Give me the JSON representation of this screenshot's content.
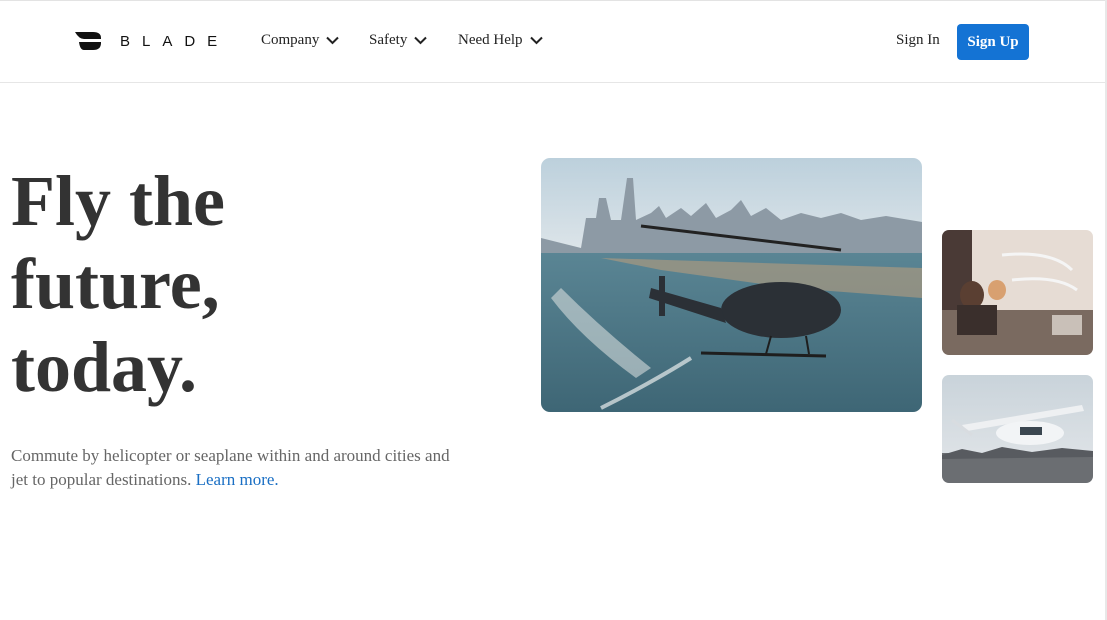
{
  "brand": {
    "name": "BLADE",
    "icon": "blade-logo-icon"
  },
  "nav": {
    "items": [
      {
        "label": "Company",
        "icon": "chevron-down-icon"
      },
      {
        "label": "Safety",
        "icon": "chevron-down-icon"
      },
      {
        "label": "Need Help",
        "icon": "chevron-down-icon"
      }
    ]
  },
  "auth": {
    "sign_in": "Sign In",
    "sign_up": "Sign Up"
  },
  "hero": {
    "headline_lines": [
      "Fly the",
      "future,",
      "today."
    ],
    "description": "Commute by helicopter or seaplane within and around cities and jet to popular destinations.",
    "learn_more": "Learn more."
  },
  "colors": {
    "accent": "#1473d4",
    "link": "#1a6fc4",
    "text": "#333333",
    "muted": "#666666"
  }
}
